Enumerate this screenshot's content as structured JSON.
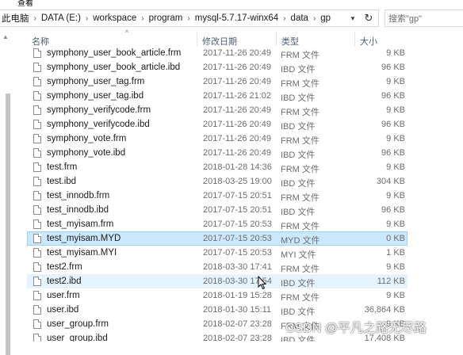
{
  "menu": {
    "view_label": "查看"
  },
  "address": {
    "crumbs": [
      "此电脑",
      "DATA (E:)",
      "workspace",
      "program",
      "mysql-5.7.17-winx64",
      "data",
      "gp"
    ]
  },
  "search": {
    "placeholder": "搜索\"gp\""
  },
  "columns": {
    "name": "名称",
    "modified": "修改日期",
    "type": "类型",
    "size": "大小"
  },
  "files": [
    {
      "name": "symphony_user_book_article.frm",
      "date": "2017-11-26 20:49",
      "type": "FRM 文件",
      "size": "9 KB"
    },
    {
      "name": "symphony_user_book_article.ibd",
      "date": "2017-11-26 20:49",
      "type": "IBD 文件",
      "size": "96 KB"
    },
    {
      "name": "symphony_user_tag.frm",
      "date": "2017-11-26 20:49",
      "type": "FRM 文件",
      "size": "9 KB"
    },
    {
      "name": "symphony_user_tag.ibd",
      "date": "2017-11-26 21:02",
      "type": "IBD 文件",
      "size": "96 KB"
    },
    {
      "name": "symphony_verifycode.frm",
      "date": "2017-11-26 20:49",
      "type": "FRM 文件",
      "size": "9 KB"
    },
    {
      "name": "symphony_verifycode.ibd",
      "date": "2017-11-26 20:49",
      "type": "IBD 文件",
      "size": "96 KB"
    },
    {
      "name": "symphony_vote.frm",
      "date": "2017-11-26 20:49",
      "type": "FRM 文件",
      "size": "9 KB"
    },
    {
      "name": "symphony_vote.ibd",
      "date": "2017-11-26 20:49",
      "type": "IBD 文件",
      "size": "96 KB"
    },
    {
      "name": "test.frm",
      "date": "2018-01-28 14:36",
      "type": "FRM 文件",
      "size": "9 KB"
    },
    {
      "name": "test.ibd",
      "date": "2018-03-25 19:00",
      "type": "IBD 文件",
      "size": "304 KB"
    },
    {
      "name": "test_innodb.frm",
      "date": "2017-07-15 20:51",
      "type": "FRM 文件",
      "size": "9 KB"
    },
    {
      "name": "test_innodb.ibd",
      "date": "2017-07-15 20:51",
      "type": "IBD 文件",
      "size": "96 KB"
    },
    {
      "name": "test_myisam.frm",
      "date": "2017-07-15 20:53",
      "type": "FRM 文件",
      "size": "9 KB"
    },
    {
      "name": "test_myisam.MYD",
      "date": "2017-07-15 20:53",
      "type": "MYD 文件",
      "size": "0 KB",
      "state": "selected"
    },
    {
      "name": "test_myisam.MYI",
      "date": "2017-07-15 20:53",
      "type": "MYI 文件",
      "size": "1 KB"
    },
    {
      "name": "test2.frm",
      "date": "2018-03-30 17:41",
      "type": "FRM 文件",
      "size": "9 KB"
    },
    {
      "name": "test2.ibd",
      "date": "2018-03-30 17:54",
      "type": "IBD 文件",
      "size": "112 KB",
      "state": "hover"
    },
    {
      "name": "user.frm",
      "date": "2018-01-19 15:28",
      "type": "FRM 文件",
      "size": "9 KB"
    },
    {
      "name": "user.ibd",
      "date": "2018-01-30 15:11",
      "type": "IBD 文件",
      "size": "36,864 KB"
    },
    {
      "name": "user_group.frm",
      "date": "2018-02-07 23:28",
      "type": "FRM 文件",
      "size": "9 KB"
    },
    {
      "name": "user_group.ibd",
      "date": "2018-02-07 23:28",
      "type": "IBD 文件",
      "size": "17,408 KB"
    }
  ],
  "watermark": "CSDN @平凡之路无尽路"
}
